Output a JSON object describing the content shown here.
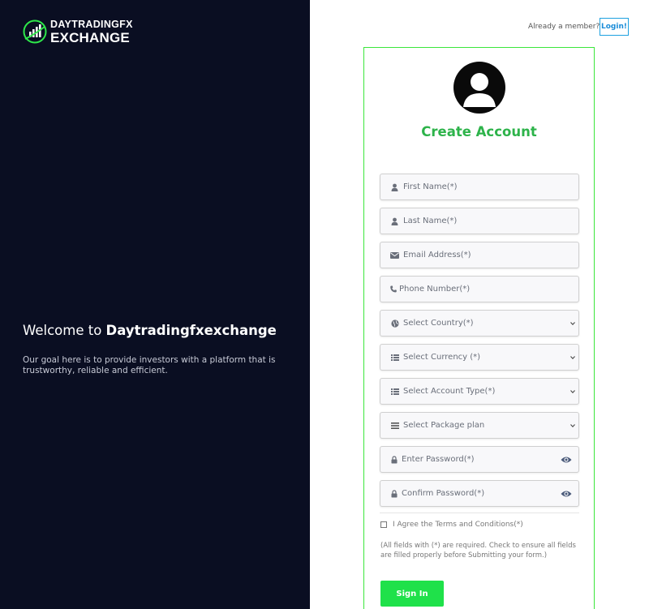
{
  "brand": {
    "name_line1": "DAYTRADINGFX",
    "name_line2": "EXCHANGE",
    "accent": "#2ee84a",
    "sidebar_bg": "#0a0e22"
  },
  "hero": {
    "welcome_prefix": "Welcome to ",
    "welcome_brand": "Daytradingfxexchange",
    "goal_text": "Our goal here is to provide investors with a platform that is trustworthy, reliable and efficient."
  },
  "header": {
    "member_text": "Already a member?",
    "login_label": "Login!"
  },
  "form": {
    "title": "Create Account",
    "fields": [
      {
        "placeholder": "First Name(*)",
        "icon": "user-icon"
      },
      {
        "placeholder": "Last Name(*)",
        "icon": "user-icon"
      },
      {
        "placeholder": "Email Address(*)",
        "icon": "envelope-icon"
      },
      {
        "placeholder": "Phone Number(*)",
        "icon": "phone-icon"
      }
    ],
    "selects": [
      {
        "label": "Select Country(*)",
        "icon": "globe-icon"
      },
      {
        "label": "Select Currency (*)",
        "icon": "list-icon"
      },
      {
        "label": "Select Account Type(*)",
        "icon": "list-icon"
      },
      {
        "label": "Select Package plan",
        "icon": "bars-icon"
      }
    ],
    "passwords": [
      {
        "placeholder": "Enter Password(*)",
        "icon": "lock-icon"
      },
      {
        "placeholder": "Confirm Password(*)",
        "icon": "lock-icon"
      }
    ],
    "agree_label": "I Agree the Terms and Conditions(*)",
    "note": "(All fields with (*) are required. Check to ensure all fields are filled properly before Submitting your form.)",
    "submit_label": "Sign In"
  }
}
